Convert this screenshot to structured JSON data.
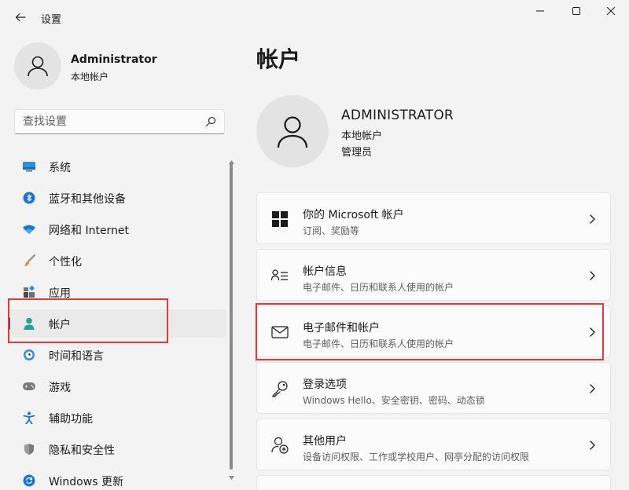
{
  "window": {
    "title": "设置",
    "controls": [
      "minimize",
      "maximize",
      "close"
    ]
  },
  "profile": {
    "name": "Administrator",
    "account_type": "本地帐户"
  },
  "search": {
    "placeholder": "查找设置"
  },
  "sidebar": {
    "items": [
      {
        "label": "系统",
        "icon": "monitor-icon",
        "active": false
      },
      {
        "label": "蓝牙和其他设备",
        "icon": "bluetooth-icon",
        "active": false
      },
      {
        "label": "网络和 Internet",
        "icon": "wifi-icon",
        "active": false
      },
      {
        "label": "个性化",
        "icon": "brush-icon",
        "active": false
      },
      {
        "label": "应用",
        "icon": "apps-icon",
        "active": false
      },
      {
        "label": "帐户",
        "icon": "person-icon",
        "active": true
      },
      {
        "label": "时间和语言",
        "icon": "clock-globe-icon",
        "active": false
      },
      {
        "label": "游戏",
        "icon": "gamepad-icon",
        "active": false
      },
      {
        "label": "辅助功能",
        "icon": "accessibility-icon",
        "active": false
      },
      {
        "label": "隐私和安全性",
        "icon": "shield-icon",
        "active": false
      },
      {
        "label": "Windows 更新",
        "icon": "update-icon",
        "active": false
      }
    ]
  },
  "main": {
    "title": "帐户",
    "account": {
      "name": "ADMINISTRATOR",
      "type": "本地帐户",
      "role": "管理员"
    },
    "cards": [
      {
        "title": "你的 Microsoft 帐户",
        "subtitle": "订阅、奖励等",
        "icon": "windows-logo-icon"
      },
      {
        "title": "帐户信息",
        "subtitle": "电子邮件、日历和联系人使用的帐户",
        "icon": "account-info-icon"
      },
      {
        "title": "电子邮件和帐户",
        "subtitle": "电子邮件、日历和联系人使用的帐户",
        "icon": "mail-icon"
      },
      {
        "title": "登录选项",
        "subtitle": "Windows Hello、安全密钥、密码、动态锁",
        "icon": "key-icon"
      },
      {
        "title": "其他用户",
        "subtitle": "设备访问权限、工作或学校用户、网亭分配的访问权限",
        "icon": "add-user-icon"
      }
    ]
  },
  "colors": {
    "accent": "#005fb8",
    "highlight": "#e53935",
    "background": "#f3f3f3",
    "card": "#fbfbfb"
  }
}
